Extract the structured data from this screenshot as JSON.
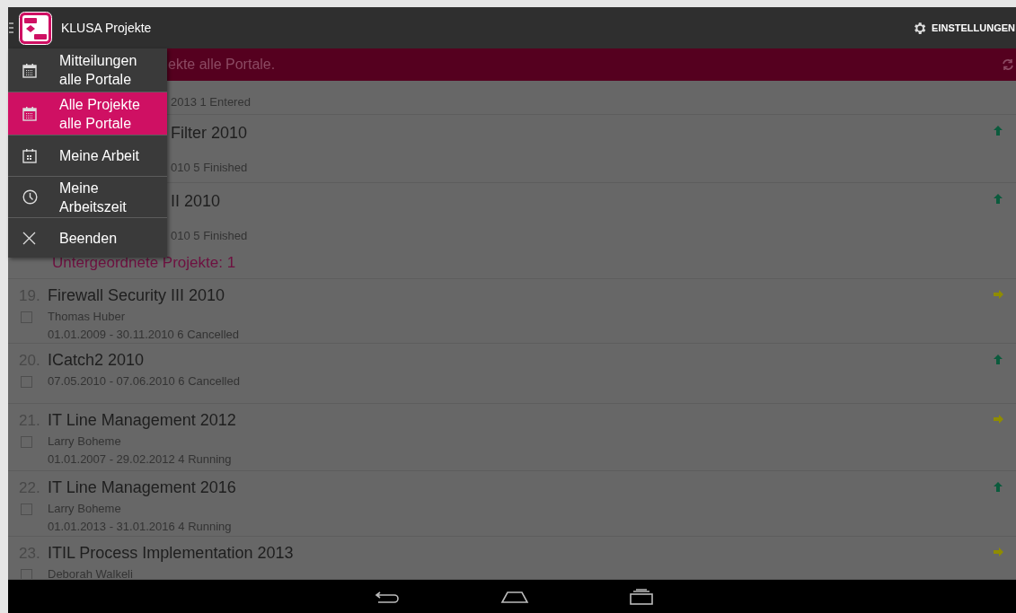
{
  "app_bar": {
    "title": "KLUSA Projekte",
    "settings_label": "EINSTELLUNGEN"
  },
  "banner": {
    "text": "ekte alle Portale."
  },
  "drawer": {
    "items": [
      {
        "label": "Mitteilungen alle Portale",
        "selected": false
      },
      {
        "label": "Alle Projekte alle Portale",
        "selected": true
      },
      {
        "label": "Meine Arbeit",
        "selected": false
      },
      {
        "label": "Meine Arbeitszeit",
        "selected": false
      },
      {
        "label": "Beenden",
        "selected": false
      }
    ]
  },
  "projects": [
    {
      "kind": "partial",
      "details": [
        "2013 1 Entered"
      ]
    },
    {
      "kind": "partial",
      "title": "Filter 2010",
      "details": [
        "010 5 Finished"
      ],
      "color": "#0b5b3d"
    },
    {
      "kind": "partial",
      "title": "II 2010",
      "details": [
        "010 5 Finished"
      ],
      "subprojects": "Untergeordnete Projekte: 1",
      "color": "#0b5b3d"
    },
    {
      "kind": "full",
      "number": "19.",
      "title": "Firewall Security III 2010",
      "details": [
        "Thomas Huber",
        "01.01.2009 - 30.11.2010 6 Cancelled"
      ],
      "checked": false,
      "color": "#8f8c00"
    },
    {
      "kind": "full",
      "number": "20.",
      "title": "ICatch2 2010",
      "details": [
        "07.05.2010 - 07.06.2010 6 Cancelled"
      ],
      "checked": false,
      "color": "#0b5b3d"
    },
    {
      "kind": "full",
      "number": "21.",
      "title": "IT Line Management 2012",
      "details": [
        "Larry Boheme",
        "01.01.2007 - 29.02.2012 4 Running"
      ],
      "checked": false,
      "color": "#8f8c00"
    },
    {
      "kind": "full",
      "number": "22.",
      "title": "IT Line Management 2016",
      "details": [
        "Larry Boheme",
        "01.01.2013 - 31.01.2016 4 Running"
      ],
      "checked": false,
      "color": "#0b5b3d"
    },
    {
      "kind": "full",
      "number": "23.",
      "title": "ITIL Process Implementation 2013",
      "details": [
        "Deborah Walkeli"
      ],
      "checked": false,
      "color": "#8f8c00"
    }
  ]
}
